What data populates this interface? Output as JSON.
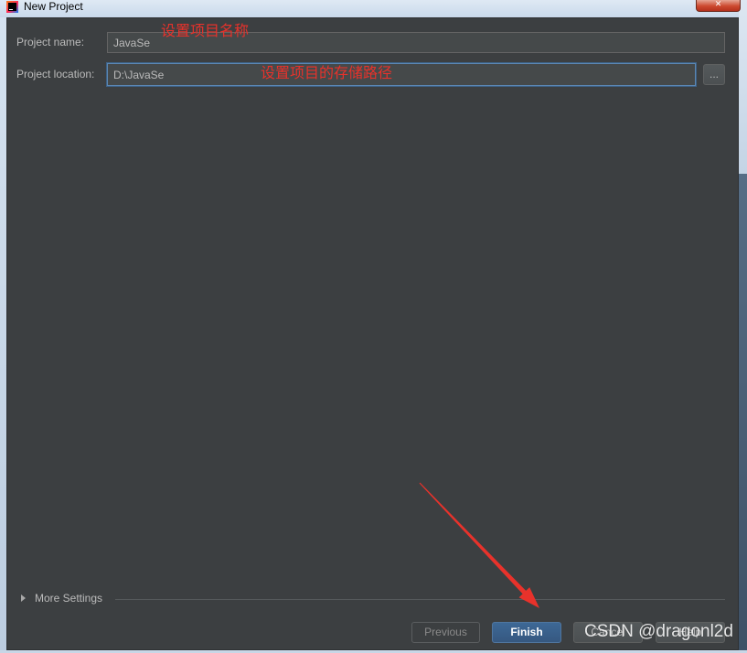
{
  "window": {
    "title": "New Project",
    "icon": "intellij-idea-icon",
    "close_icon": "close-icon"
  },
  "form": {
    "project_name": {
      "label": "Project name:",
      "value": "JavaSe"
    },
    "project_location": {
      "label": "Project location:",
      "value": "D:\\JavaSe",
      "browse_label": "..."
    }
  },
  "more_settings": {
    "label": "More Settings",
    "icon": "triangle-right-icon"
  },
  "buttons": {
    "previous": "Previous",
    "finish": "Finish",
    "cancel": "Cancel",
    "help": "Help"
  },
  "annotations": {
    "name_hint": "设置项目名称",
    "location_hint": "设置项目的存储路径",
    "arrow_icon": "red-arrow-icon"
  },
  "watermark": "CSDN @dragonl2d",
  "colors": {
    "panel_bg": "#3c3f41",
    "field_bg": "#45494a",
    "focus_border": "#3d6185",
    "default_button_bg": "#365880",
    "annotation_red": "#e8322b"
  }
}
